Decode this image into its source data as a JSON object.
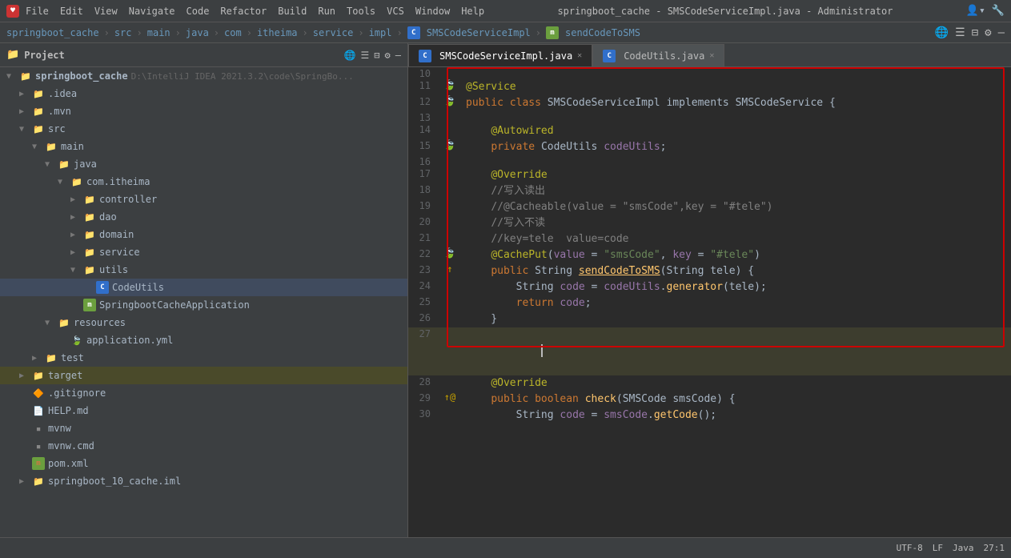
{
  "titleBar": {
    "title": "springboot_cache - SMSCodeServiceImpl.java - Administrator",
    "menus": [
      "File",
      "Edit",
      "View",
      "Navigate",
      "Code",
      "Refactor",
      "Build",
      "Run",
      "Tools",
      "VCS",
      "Window",
      "Help"
    ]
  },
  "breadcrumb": {
    "items": [
      "springboot_cache",
      "src",
      "main",
      "java",
      "com",
      "itheima",
      "service",
      "impl",
      "SMSCodeServiceImpl",
      "sendCodeToSMS"
    ]
  },
  "sidebar": {
    "title": "Project",
    "rootLabel": "springboot_cache",
    "rootPath": "D:\\IntelliJ IDEA 2021.3.2\\code\\SpringBo..."
  },
  "tabs": [
    {
      "label": "SMSCodeServiceImpl.java",
      "active": true
    },
    {
      "label": "CodeUtils.java",
      "active": false
    }
  ],
  "editor": {
    "lines": [
      {
        "num": 10,
        "gutter": "",
        "code": ""
      },
      {
        "num": 11,
        "gutter": "",
        "code": "@Service"
      },
      {
        "num": 12,
        "gutter": "",
        "code": "public class SMSCodeServiceImpl implements SMSCodeService {"
      },
      {
        "num": 13,
        "gutter": "",
        "code": ""
      },
      {
        "num": 14,
        "gutter": "",
        "code": "    @Autowired"
      },
      {
        "num": 15,
        "gutter": "leaf",
        "code": "    private CodeUtils codeUtils;"
      },
      {
        "num": 16,
        "gutter": "",
        "code": ""
      },
      {
        "num": 17,
        "gutter": "",
        "code": "    @Override"
      },
      {
        "num": 18,
        "gutter": "",
        "code": "    //写入读出"
      },
      {
        "num": 19,
        "gutter": "",
        "code": "    //@Cacheable(value = \"smsCode\",key = \"#tele\")"
      },
      {
        "num": 20,
        "gutter": "",
        "code": "    //写入不读"
      },
      {
        "num": 21,
        "gutter": "",
        "code": "    //key=tele  value=code"
      },
      {
        "num": 22,
        "gutter": "leaf",
        "code": "    @CachePut(value = \"smsCode\", key = \"#tele\")"
      },
      {
        "num": 23,
        "gutter": "arrow-up",
        "code": "    public String sendCodeToSMS(String tele) {"
      },
      {
        "num": 24,
        "gutter": "",
        "code": "        String code = codeUtils.generator(tele);"
      },
      {
        "num": 25,
        "gutter": "",
        "code": "        return code;"
      },
      {
        "num": 26,
        "gutter": "",
        "code": "    }"
      },
      {
        "num": 27,
        "gutter": "",
        "code": ""
      },
      {
        "num": 28,
        "gutter": "",
        "code": "    @Override"
      },
      {
        "num": 29,
        "gutter": "arrow-up-at",
        "code": "    public boolean check(SMSCode smsCode) {"
      },
      {
        "num": 30,
        "gutter": "",
        "code": "        String code = smsCode.getCode();"
      }
    ]
  },
  "statusBar": {
    "left": "",
    "right": [
      "UTF-8",
      "LF",
      "Java",
      "27:1"
    ]
  }
}
